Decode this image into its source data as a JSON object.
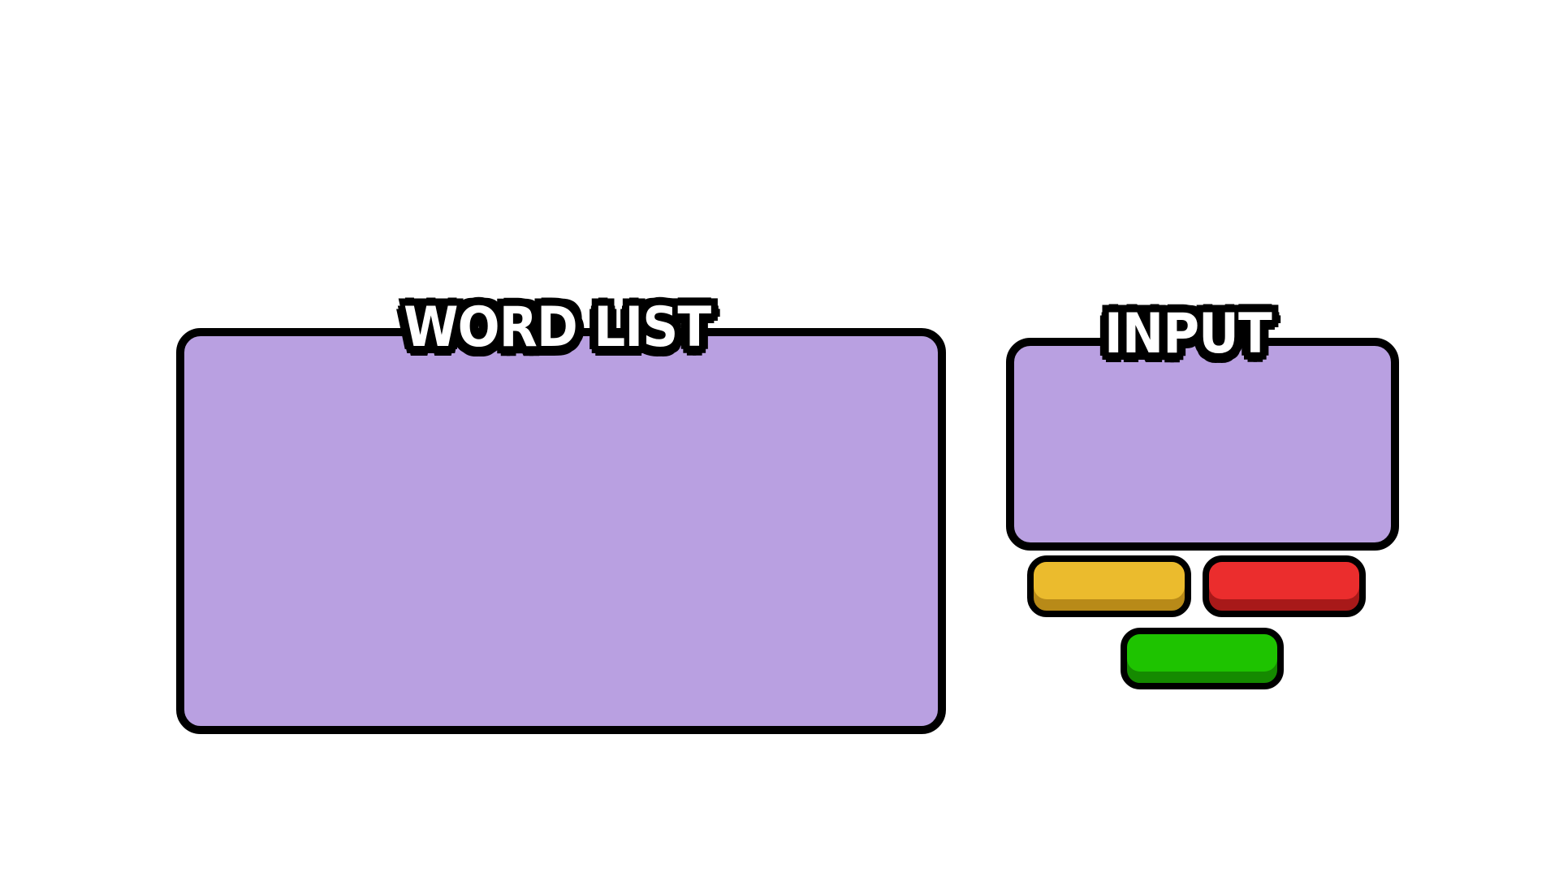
{
  "word_list": {
    "title": "WORD LIST"
  },
  "input": {
    "title": "INPUT",
    "value": ""
  },
  "buttons": {
    "yellow": {
      "color": "#ebbb2d",
      "shade": "#b88a18",
      "label": ""
    },
    "red": {
      "color": "#eb2d2d",
      "shade": "#a81919",
      "label": ""
    },
    "green": {
      "color": "#1ec300",
      "shade": "#158a00",
      "label": ""
    }
  },
  "colors": {
    "panel_fill": "#b9a0e1",
    "outline": "#000000",
    "background": "#ffffff"
  }
}
